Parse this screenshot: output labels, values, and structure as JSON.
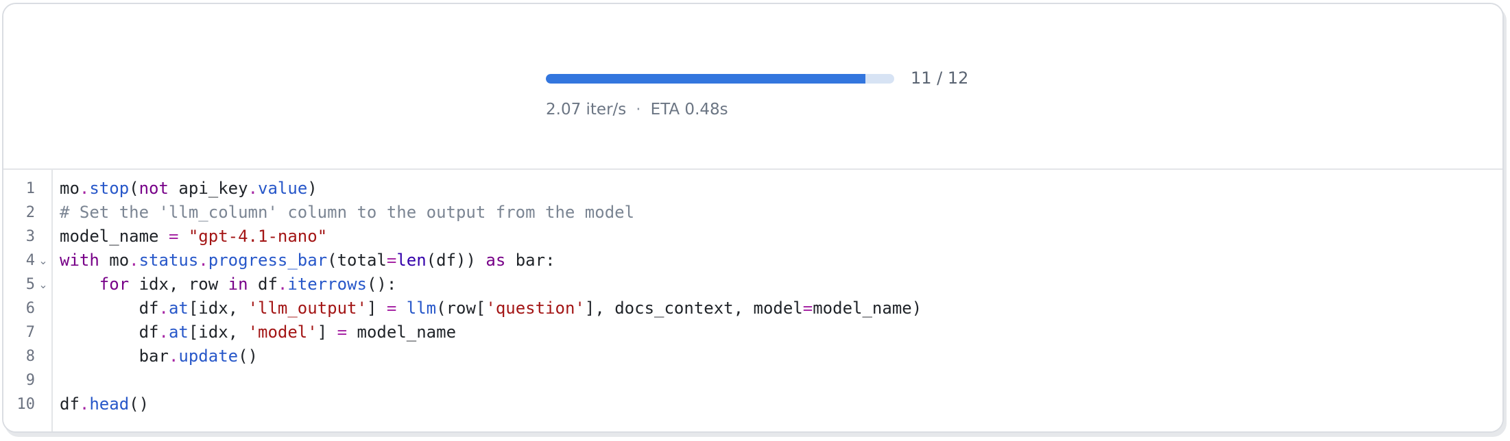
{
  "progress": {
    "count_text": "11 / 12",
    "fraction": 0.917,
    "rate_text": "2.07 iter/s",
    "separator": "·",
    "eta_text": "ETA 0.48s",
    "colors": {
      "fill": "#3376de",
      "track": "#d7e3f4"
    }
  },
  "editor": {
    "line_numbers": [
      "1",
      "2",
      "3",
      "4",
      "5",
      "6",
      "7",
      "8",
      "9",
      "10"
    ],
    "fold_markers": {
      "line4": "⌄",
      "line5": "⌄"
    },
    "lines": [
      [
        [
          "mo",
          ""
        ],
        [
          ".",
          "op"
        ],
        [
          "stop",
          "fn"
        ],
        [
          "(",
          ""
        ],
        [
          "not",
          "kw"
        ],
        [
          " api_key",
          ""
        ],
        [
          ".",
          "op"
        ],
        [
          "value",
          "fn"
        ],
        [
          ")",
          ""
        ]
      ],
      [
        [
          "# Set the 'llm_column' column to the output from the model",
          "cm"
        ]
      ],
      [
        [
          "model_name ",
          ""
        ],
        [
          "=",
          "op"
        ],
        [
          " ",
          ""
        ],
        [
          "\"gpt-4.1-nano\"",
          "str"
        ]
      ],
      [
        [
          "with",
          "kw"
        ],
        [
          " mo",
          ""
        ],
        [
          ".",
          "op"
        ],
        [
          "status",
          "fn"
        ],
        [
          ".",
          "op"
        ],
        [
          "progress_bar",
          "fn"
        ],
        [
          "(total",
          ""
        ],
        [
          "=",
          "op"
        ],
        [
          "len",
          "bi"
        ],
        [
          "(df)) ",
          ""
        ],
        [
          "as",
          "kw"
        ],
        [
          " bar:",
          ""
        ]
      ],
      [
        [
          "    ",
          ""
        ],
        [
          "for",
          "kw"
        ],
        [
          " idx, row ",
          ""
        ],
        [
          "in",
          "kw"
        ],
        [
          " df",
          ""
        ],
        [
          ".",
          "op"
        ],
        [
          "iterrows",
          "fn"
        ],
        [
          "():",
          ""
        ]
      ],
      [
        [
          "        df",
          ""
        ],
        [
          ".",
          "op"
        ],
        [
          "at",
          "fn"
        ],
        [
          "[idx, ",
          ""
        ],
        [
          "'llm_output'",
          "str"
        ],
        [
          "] ",
          ""
        ],
        [
          "=",
          "op"
        ],
        [
          " ",
          ""
        ],
        [
          "llm",
          "fn"
        ],
        [
          "(row[",
          ""
        ],
        [
          "'question'",
          "str"
        ],
        [
          "], docs_context, model",
          ""
        ],
        [
          "=",
          "op"
        ],
        [
          "model_name)",
          ""
        ]
      ],
      [
        [
          "        df",
          ""
        ],
        [
          ".",
          "op"
        ],
        [
          "at",
          "fn"
        ],
        [
          "[idx, ",
          ""
        ],
        [
          "'model'",
          "str"
        ],
        [
          "] ",
          ""
        ],
        [
          "=",
          "op"
        ],
        [
          " model_name",
          ""
        ]
      ],
      [
        [
          "        bar",
          ""
        ],
        [
          ".",
          "op"
        ],
        [
          "update",
          "fn"
        ],
        [
          "()",
          ""
        ]
      ],
      [],
      [
        [
          "df",
          ""
        ],
        [
          ".",
          "op"
        ],
        [
          "head",
          "fn"
        ],
        [
          "()",
          ""
        ]
      ]
    ]
  }
}
